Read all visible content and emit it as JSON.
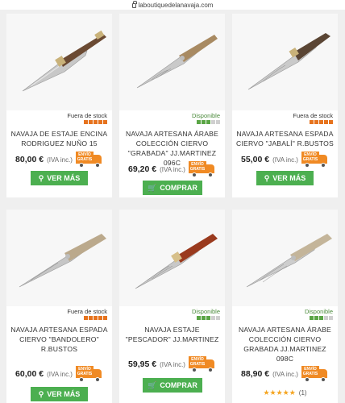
{
  "browser": {
    "url": "laboutiquedelanavaja.com"
  },
  "colors": {
    "accent": "#4caf50",
    "out_of_stock": "#e6731e",
    "in_stock": "#5aa545",
    "shipping": "#f08a24"
  },
  "products": [
    {
      "title": "NAVAJA DE ESTAJE ENCINA RODRIGUEZ NUÑO 15",
      "stock_label": "Fuera de stock",
      "price": "80,00 €",
      "tax": "(IVA inc.)",
      "shipping_badge": "ENVÍO GRATIS",
      "button": "VER MÁS",
      "button_icon": "search-icon"
    },
    {
      "title": "NAVAJA ARTESANA ÁRABE COLECCIÓN CIERVO \"GRABADA\" JJ.MARTINEZ 096C",
      "stock_label": "Disponible",
      "price": "69,20 €",
      "tax": "(IVA inc.)",
      "shipping_badge": "ENVÍO GRATIS",
      "button": "COMPRAR",
      "button_icon": "cart-icon"
    },
    {
      "title": "NAVAJA ARTESANA ESPADA CIERVO \"JABALÍ\" R.BUSTOS",
      "stock_label": "Fuera de stock",
      "price": "55,00 €",
      "tax": "(IVA inc.)",
      "shipping_badge": "ENVÍO GRATIS",
      "button": "VER MÁS",
      "button_icon": "search-icon"
    },
    {
      "title": "NAVAJA ARTESANA ESPADA CIERVO \"BANDOLERO\" R.BUSTOS",
      "stock_label": "Fuera de stock",
      "price": "60,00 €",
      "tax": "(IVA inc.)",
      "shipping_badge": "ENVÍO GRATIS",
      "button": "VER MÁS",
      "button_icon": "search-icon"
    },
    {
      "title": "NAVAJA ESTAJE \"PESCADOR\" JJ.MARTINEZ",
      "stock_label": "Disponible",
      "price": "59,95 €",
      "tax": "(IVA inc.)",
      "shipping_badge": "ENVÍO GRATIS",
      "button": "COMPRAR",
      "button_icon": "cart-icon"
    },
    {
      "title": "NAVAJA ARTESANA ÁRABE COLECCIÓN CIERVO GRABADA JJ.MARTINEZ 098C",
      "stock_label": "Disponible",
      "price": "88,90 €",
      "tax": "(IVA inc.)",
      "shipping_badge": "ENVÍO GRATIS",
      "rating_stars": "★★★★★",
      "rating_count": "(1)"
    }
  ]
}
